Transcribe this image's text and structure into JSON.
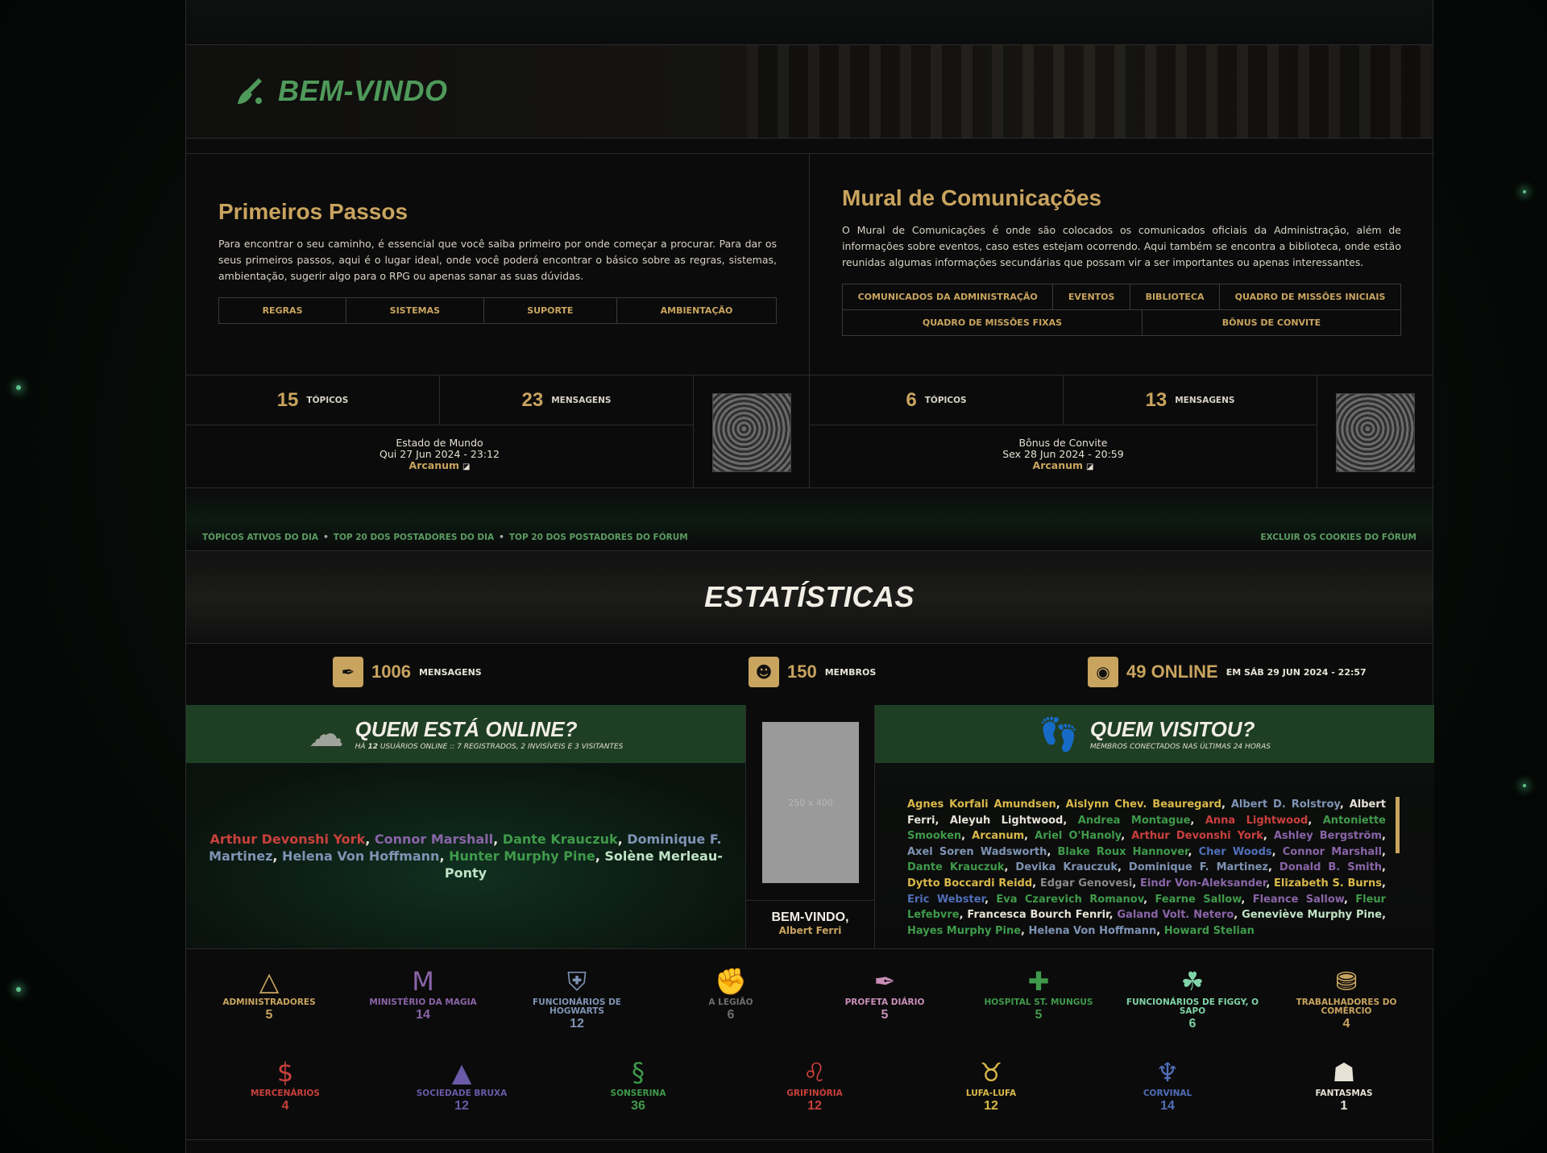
{
  "banner": {
    "title": "BEM-VINDO"
  },
  "forums": [
    {
      "title": "Primeiros Passos",
      "description": "Para encontrar o seu caminho, é essencial que você saiba primeiro por onde começar a procurar. Para dar os seus primeiros passos, aqui é o lugar ideal, onde você poderá encontrar o básico sobre as regras, sistemas, ambientação, sugerir algo para o RPG ou apenas sanar as suas dúvidas.",
      "links": [
        "REGRAS",
        "SISTEMAS",
        "SUPORTE",
        "AMBIENTAÇÃO"
      ],
      "topics": "15",
      "topics_label": "TÓPICOS",
      "messages": "23",
      "messages_label": "MENSAGENS",
      "last_title": "Estado de Mundo",
      "last_date": "Qui 27 Jun 2024 - 23:12",
      "last_author": "Arcanum"
    },
    {
      "title": "Mural de Comunicações",
      "description": "O Mural de Comunicações é onde são colocados os comunicados oficiais da Administração, além de informações sobre eventos, caso estes estejam ocorrendo. Aqui também se encontra a biblioteca, onde estão reunidas algumas informações secundárias que possam vir a ser importantes ou apenas interessantes.",
      "links_row1": [
        "COMUNICADOS DA ADMINISTRAÇÃO",
        "EVENTOS",
        "BIBLIOTECA",
        "QUADRO DE MISSÕES INICIAIS"
      ],
      "links_row2": [
        "QUADRO DE MISSÕES FIXAS",
        "BÔNUS DE CONVITE"
      ],
      "topics": "6",
      "topics_label": "TÓPICOS",
      "messages": "13",
      "messages_label": "MENSAGENS",
      "last_title": "Bônus de Convite",
      "last_date": "Sex 28 Jun 2024 - 20:59",
      "last_author": "Arcanum"
    }
  ],
  "linkbar": {
    "left": [
      "TÓPICOS ATIVOS DO DIA",
      "TOP 20 DOS POSTADORES DO DIA",
      "TOP 20 DOS POSTADORES DO FÓRUM"
    ],
    "right": "EXCLUIR OS COOKIES DO FÓRUM"
  },
  "stats": {
    "title": "ESTATÍSTICAS",
    "messages": "1006",
    "messages_label": "MENSAGENS",
    "members": "150",
    "members_label": "MEMBROS",
    "online": "49 ONLINE",
    "online_label": "EM SÁB 29 JUN 2024 - 22:57"
  },
  "online": {
    "title": "QUEM ESTÁ ONLINE?",
    "subtitle_pre": "HÁ ",
    "subtitle_num": "12",
    "subtitle_post": " USUÁRIOS ONLINE :: 7 REGISTRADOS, 2 INVISÍVEIS E 3 VISITANTES",
    "users": [
      {
        "name": "Arthur Devonshi York",
        "color": "#c9403c"
      },
      {
        "name": "Connor Marshall",
        "color": "#8a64a8"
      },
      {
        "name": "Dante Krauczuk",
        "color": "#3f9a4a"
      },
      {
        "name": "Dominique F. Martinez",
        "color": "#7f93b4"
      },
      {
        "name": "Helena Von Hoffmann",
        "color": "#7f93b4"
      },
      {
        "name": "Hunter Murphy Pine",
        "color": "#3f9a4a"
      },
      {
        "name": "Solène Merleau-Ponty",
        "color": "#bfe3c4"
      }
    ]
  },
  "middle": {
    "placeholder": "250 x 400",
    "welcome": "BEM-VINDO,",
    "user": "Albert Ferri"
  },
  "visited": {
    "title": "QUEM VISITOU?",
    "subtitle": "MEMBROS CONECTADOS NAS ÚLTIMAS 24 HORAS",
    "users": [
      {
        "name": "Agnes Korfali Amundsen",
        "color": "#d9b84a"
      },
      {
        "name": "Aislynn Chev. Beauregard",
        "color": "#d9b84a"
      },
      {
        "name": "Albert D. Rolstroy",
        "color": "#7f93b4"
      },
      {
        "name": "Albert Ferri",
        "color": "#e6e2d6"
      },
      {
        "name": "Aleyuh Lightwood",
        "color": "#e6e2d6"
      },
      {
        "name": "Andrea Montague",
        "color": "#3f9a4a"
      },
      {
        "name": "Anna Lightwood",
        "color": "#c9403c"
      },
      {
        "name": "Antoniette Smooken",
        "color": "#3f9a4a"
      },
      {
        "name": "Arcanum",
        "color": "#d9b84a"
      },
      {
        "name": "Ariel O'Hanoly",
        "color": "#3f9a4a"
      },
      {
        "name": "Arthur Devonshi York",
        "color": "#c9403c"
      },
      {
        "name": "Ashley Bergström",
        "color": "#8a64a8"
      },
      {
        "name": "Axel Soren Wadsworth",
        "color": "#7f93b4"
      },
      {
        "name": "Blake Roux Hannover",
        "color": "#3f9a4a"
      },
      {
        "name": "Cher Woods",
        "color": "#4f6fb8"
      },
      {
        "name": "Connor Marshall",
        "color": "#8a64a8"
      },
      {
        "name": "Dante Krauczuk",
        "color": "#3f9a4a"
      },
      {
        "name": "Devika Krauczuk",
        "color": "#7f93b4"
      },
      {
        "name": "Dominique F. Martinez",
        "color": "#7f93b4"
      },
      {
        "name": "Donald B. Smith",
        "color": "#8a64a8"
      },
      {
        "name": "Dytto Boccardi Reidd",
        "color": "#d9b84a"
      },
      {
        "name": "Edgar Genovesi",
        "color": "#8a8a8a"
      },
      {
        "name": "Eindr Von-Aleksander",
        "color": "#8a64a8"
      },
      {
        "name": "Elizabeth S. Burns",
        "color": "#d9b84a"
      },
      {
        "name": "Eric Webster",
        "color": "#4f6fb8"
      },
      {
        "name": "Eva Czarevich Romanov",
        "color": "#3f9a4a"
      },
      {
        "name": "Fearne Sallow",
        "color": "#3f9a4a"
      },
      {
        "name": "Fleance Sallow",
        "color": "#8a64a8"
      },
      {
        "name": "Fleur Lefebvre",
        "color": "#3f9a4a"
      },
      {
        "name": "Francesca Bourch Fenrir",
        "color": "#e6e2d6"
      },
      {
        "name": "Galand Volt. Netero",
        "color": "#8a64a8"
      },
      {
        "name": "Geneviève Murphy Pine",
        "color": "#bfe3c4"
      },
      {
        "name": "Hayes Murphy Pine",
        "color": "#3f9a4a"
      },
      {
        "name": "Helena Von Hoffmann",
        "color": "#7f93b4"
      },
      {
        "name": "Howard Stelian",
        "color": "#3f9a4a"
      }
    ]
  },
  "groups": [
    {
      "name": "ADMINISTRADORES",
      "count": "5",
      "color": "#c9a45f",
      "icon": "deathly-hallows-icon",
      "glyph": "△"
    },
    {
      "name": "MINISTÉRIO DA MAGIA",
      "count": "14",
      "color": "#8a64a8",
      "icon": "ministry-icon",
      "glyph": "M"
    },
    {
      "name": "FUNCIONÁRIOS DE HOGWARTS",
      "count": "12",
      "color": "#7f93b4",
      "icon": "hogwarts-crest-icon",
      "glyph": "⛨"
    },
    {
      "name": "A LEGIÃO",
      "count": "6",
      "color": "#6d6d6d",
      "icon": "fist-icon",
      "glyph": "✊"
    },
    {
      "name": "PROFETA DIÁRIO",
      "count": "5",
      "color": "#c98fb8",
      "icon": "quill-icon",
      "glyph": "✒"
    },
    {
      "name": "HOSPITAL ST. MUNGUS",
      "count": "5",
      "color": "#3f9a4a",
      "icon": "medical-cross-icon",
      "glyph": "✚"
    },
    {
      "name": "FUNCIONÁRIOS DE FIGGY, O SAPO",
      "count": "6",
      "color": "#7fd3a6",
      "icon": "frog-icon",
      "glyph": "☘"
    },
    {
      "name": "TRABALHADORES DO COMÉRCIO",
      "count": "4",
      "color": "#c9a45f",
      "icon": "coins-icon",
      "glyph": "⛃"
    },
    {
      "name": "MERCENÁRIOS",
      "count": "4",
      "color": "#c9403c",
      "icon": "money-bag-icon",
      "glyph": "$"
    },
    {
      "name": "SOCIEDADE BRUXA",
      "count": "12",
      "color": "#6a5aa8",
      "icon": "witch-hat-icon",
      "glyph": "▲"
    },
    {
      "name": "SONSERINA",
      "count": "36",
      "color": "#3f9a4a",
      "icon": "serpent-icon",
      "glyph": "§"
    },
    {
      "name": "GRIFINÓRIA",
      "count": "12",
      "color": "#c9403c",
      "icon": "lion-icon",
      "glyph": "♌"
    },
    {
      "name": "LUFA-LUFA",
      "count": "12",
      "color": "#d9b84a",
      "icon": "badger-icon",
      "glyph": "♉"
    },
    {
      "name": "CORVINAL",
      "count": "14",
      "color": "#4f6fb8",
      "icon": "eagle-icon",
      "glyph": "♆"
    },
    {
      "name": "FANTASMAS",
      "count": "1",
      "color": "#e6e2d6",
      "icon": "ghost-icon",
      "glyph": "☗"
    }
  ]
}
